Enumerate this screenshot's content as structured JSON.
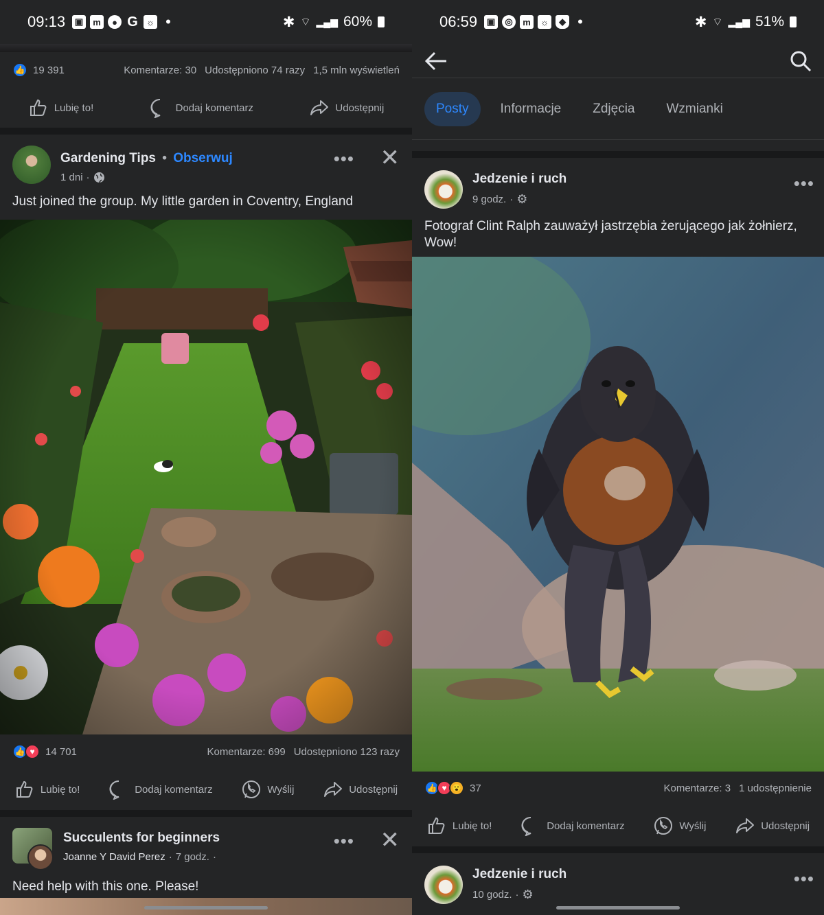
{
  "left": {
    "status": {
      "time": "09:13",
      "battery": "60%"
    },
    "top_post": {
      "like_count": "19 391",
      "comments": "Komentarze: 30",
      "shares": "Udostępniono 74 razy",
      "views": "1,5 mln wyświetleń",
      "actions": {
        "like": "Lubię to!",
        "comment": "Dodaj komentarz",
        "share": "Udostępnij"
      }
    },
    "post1": {
      "author": "Gardening Tips",
      "separator": "•",
      "follow": "Obserwuj",
      "time": "1 dni",
      "meta_sep": "·",
      "text": "Just joined the group. My little garden in Coventry, England",
      "reaction_count": "14 701",
      "comments": "Komentarze: 699",
      "shares": "Udostępniono 123 razy",
      "actions": {
        "like": "Lubię to!",
        "comment": "Dodaj komentarz",
        "send": "Wyślij",
        "share": "Udostępnij"
      }
    },
    "post2": {
      "group": "Succulents for beginners",
      "author": "Joanne Y David Perez",
      "time": "7 godz.",
      "meta_sep": "·",
      "text": "Need help with this one. Please!"
    }
  },
  "right": {
    "status": {
      "time": "06:59",
      "battery": "51%"
    },
    "tabs": [
      "Posty",
      "Informacje",
      "Zdjęcia",
      "Wzmianki"
    ],
    "post1": {
      "author": "Jedzenie i ruch",
      "time": "9 godz.",
      "meta_sep": "·",
      "text": "Fotograf Clint Ralph zauważył jastrzębia żerującego jak żołnierz, Wow!",
      "reaction_count": "37",
      "comments": "Komentarze: 3",
      "shares": "1 udostępnienie",
      "actions": {
        "like": "Lubię to!",
        "comment": "Dodaj komentarz",
        "send": "Wyślij",
        "share": "Udostępnij"
      }
    },
    "post2": {
      "author": "Jedzenie i ruch",
      "time": "10 godz.",
      "meta_sep": "·"
    }
  },
  "colors": {
    "bg": "#242526",
    "text": "#e4e6eb",
    "muted": "#b0b3b8",
    "accent": "#2d88ff",
    "like_blue": "#1877f2",
    "love_red": "#f33e58"
  },
  "icons": [
    "like-icon",
    "comment-icon",
    "share-icon",
    "messenger-icon",
    "globe-icon",
    "gear-icon",
    "back-arrow-icon",
    "search-icon",
    "close-icon",
    "more-icon"
  ]
}
